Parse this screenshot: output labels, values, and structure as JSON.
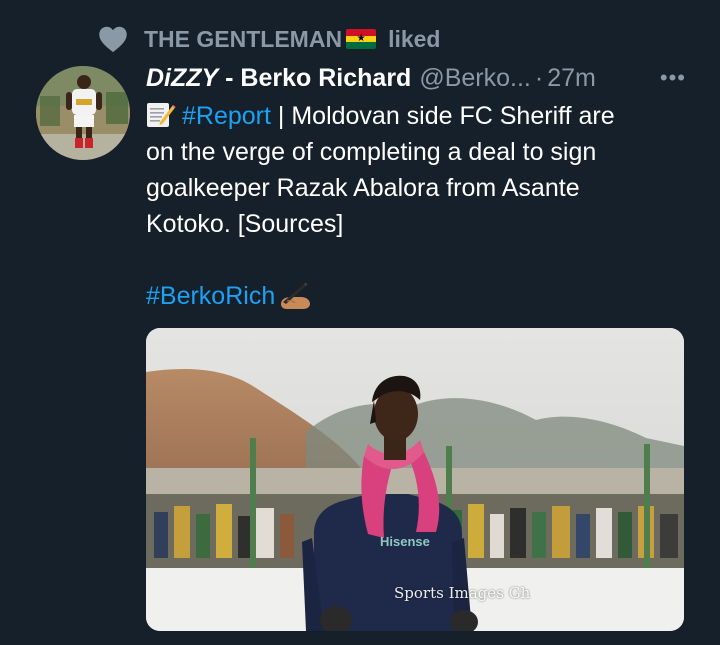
{
  "context": {
    "icon": "heart-icon",
    "user": "THE GENTLEMAN",
    "flag": "ghana-flag",
    "action": "liked"
  },
  "tweet": {
    "name_italic": "DiZZY",
    "name_rest": " - Berko Richard",
    "handle": "@Berko...",
    "separator": "·",
    "time": "27m",
    "more": "•••",
    "report_tag": "#Report",
    "line1_rest": " | Moldovan side FC Sheriff are",
    "line2": "on the verge of completing a deal to sign",
    "line3": "goalkeeper Razak Abalora from Asante",
    "line4": "Kotoko. [Sources]",
    "tag2": "#BerkoRich"
  },
  "media": {
    "shirt_text": "Hisense",
    "watermark": "Sports Images Gh"
  },
  "colors": {
    "background": "#15202b",
    "secondary_text": "#8b98a5",
    "link": "#1da1f2"
  }
}
